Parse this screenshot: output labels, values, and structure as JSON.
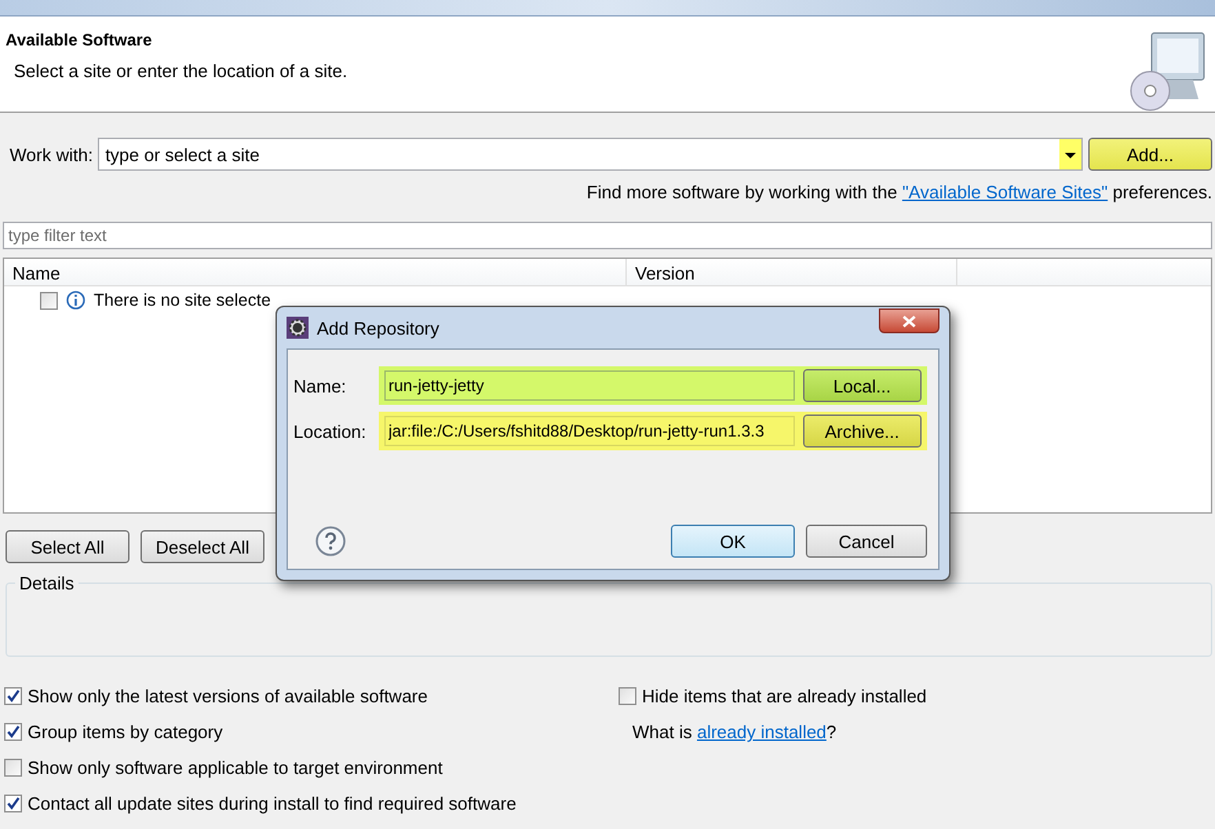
{
  "header": {
    "title": "Available Software",
    "subtitle": "Select a site or enter the location of a site."
  },
  "work_with": {
    "label": "Work with:",
    "placeholder": "type or select a site",
    "add_button": "Add...",
    "hint_before": "Find more software by working with the ",
    "hint_link": "\"Available Software Sites\"",
    "hint_after": " preferences."
  },
  "filter": {
    "placeholder": "type filter text"
  },
  "table": {
    "columns": [
      "Name",
      "Version"
    ],
    "rows": [
      {
        "name": "There is no site selecte",
        "checked": false
      }
    ]
  },
  "buttons": [
    "Select All",
    "Deselect All"
  ],
  "details": {
    "title": "Details"
  },
  "options_left": [
    {
      "label": "Show only the latest versions of available software",
      "checked": true
    },
    {
      "label": "Group items by category",
      "checked": true
    },
    {
      "label": "Show only software applicable to target environment",
      "checked": false
    },
    {
      "label": "Contact all update sites during install to find required software",
      "checked": true
    }
  ],
  "options_right": {
    "hide_installed": {
      "label": "Hide items that are already installed",
      "checked": false
    },
    "what_is": "What is ",
    "what_is_link": "already installed",
    "what_is_after": "?"
  },
  "dialog": {
    "title": "Add Repository",
    "name_label": "Name:",
    "name_value": "run-jetty-jetty",
    "local_button": "Local...",
    "location_label": "Location:",
    "location_value": "jar:file:/C:/Users/fshitd88/Desktop/run-jetty-run1.3.3",
    "archive_button": "Archive...",
    "ok": "OK",
    "cancel": "Cancel"
  }
}
